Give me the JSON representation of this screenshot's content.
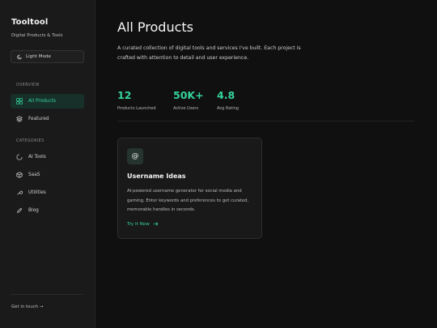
{
  "sidebar": {
    "brand": "Tooltool",
    "tagline": "Digital Products & Tools",
    "mode_button": "Light Mode",
    "overview_label": "OVERVIEW",
    "overview_items": [
      {
        "label": "All Products",
        "icon": "grid-icon",
        "active": true
      },
      {
        "label": "Featured",
        "icon": "layers-icon",
        "active": false
      }
    ],
    "categories_label": "CATEGORIES",
    "category_items": [
      {
        "label": "AI Tools",
        "icon": "spinner-icon"
      },
      {
        "label": "SaaS",
        "icon": "box-icon"
      },
      {
        "label": "Utilities",
        "icon": "wrench-icon"
      },
      {
        "label": "Blog",
        "icon": "pen-icon"
      }
    ],
    "footer_link": "Get in touch →"
  },
  "main": {
    "title": "All Products",
    "description": "A curated collection of digital tools and services I've built. Each project is crafted with attention to detail and user experience.",
    "stats": [
      {
        "value": "12",
        "label": "Products Launched"
      },
      {
        "value": "50K+",
        "label": "Active Users"
      },
      {
        "value": "4.8",
        "label": "Avg Rating"
      }
    ],
    "card": {
      "icon": "@",
      "title": "Username Ideas",
      "description": "AI-powered username generator for social media and gaming. Enter keywords and preferences to get curated, memorable handles in seconds.",
      "link": "Try It Now"
    }
  },
  "colors": {
    "accent": "#34d399",
    "background": "#101010",
    "sidebar": "#1a1a1a",
    "card": "#191919"
  }
}
